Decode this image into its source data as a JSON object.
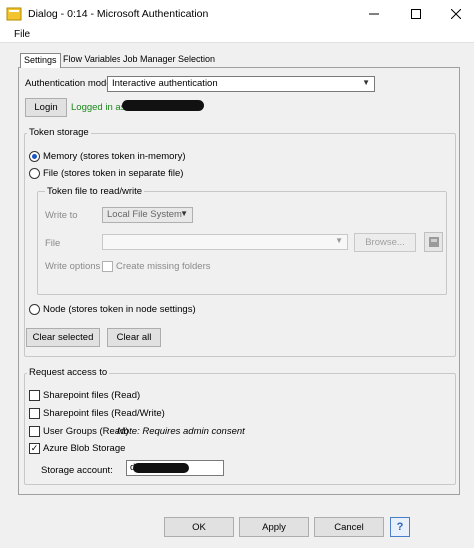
{
  "window": {
    "title": "Dialog - 0:14 - Microsoft Authentication",
    "minimize_icon": "minimize-icon",
    "maximize_icon": "maximize-icon",
    "close_icon": "close-icon"
  },
  "menu": {
    "file": "File"
  },
  "tabs": [
    {
      "label": "Settings",
      "active": true
    },
    {
      "label": "Flow Variables",
      "active": false
    },
    {
      "label": "Job Manager Selection",
      "active": false
    }
  ],
  "auth": {
    "mode_label": "Authentication mode:",
    "mode_value": "Interactive authentication",
    "login_button": "Login",
    "logged_in_text": "Logged in as"
  },
  "token_storage": {
    "title": "Token storage",
    "memory_label": "Memory (stores token in-memory)",
    "memory_checked": true,
    "file_label": "File (stores token in separate file)",
    "file_checked": false,
    "file_group": {
      "title": "Token file to read/write",
      "write_to_label": "Write to",
      "write_to_value": "Local File System",
      "file_label": "File",
      "file_value": "",
      "browse_button": "Browse...",
      "write_options_label": "Write options",
      "create_folders_label": "Create missing folders"
    },
    "node_label": "Node (stores token in node settings)",
    "node_checked": false,
    "clear_selected_button": "Clear selected",
    "clear_all_button": "Clear all"
  },
  "request_access": {
    "title": "Request access to",
    "items": [
      {
        "label": "Sharepoint files (Read)",
        "checked": false
      },
      {
        "label": "Sharepoint files (Read/Write)",
        "checked": false
      },
      {
        "label": "User Groups (Read)",
        "note": "Note: Requires admin consent",
        "checked": false
      },
      {
        "label": "Azure Blob Storage",
        "checked": true
      }
    ],
    "storage_account_label": "Storage account:",
    "storage_account_value": "d"
  },
  "footer": {
    "ok": "OK",
    "apply": "Apply",
    "cancel": "Cancel",
    "help_icon": "help-icon"
  },
  "colors": {
    "accent": "#1a56c4",
    "logged_in_green": "#1a8a1a",
    "dialog_bg": "#f0f0f0"
  }
}
